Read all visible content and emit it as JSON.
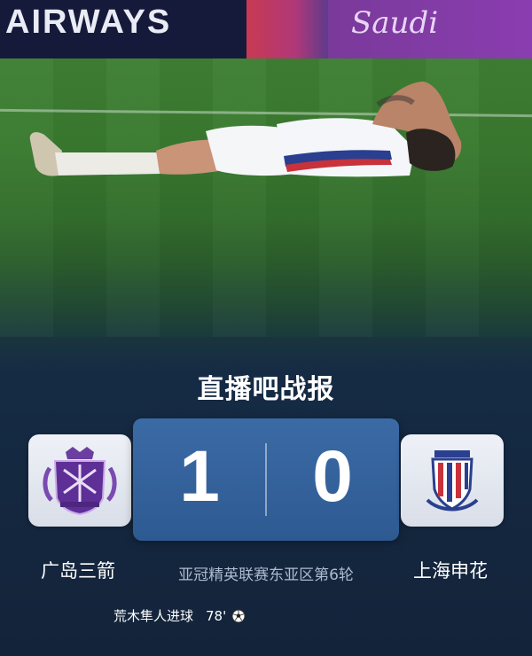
{
  "banner": {
    "sponsor_text": "AIRWAYS",
    "sponsor_text_right": "Saudi"
  },
  "header": {
    "title": "直播吧战报"
  },
  "match": {
    "home_team": "广岛三箭",
    "away_team": "上海申花",
    "home_score": "1",
    "away_score": "0",
    "competition": "亚冠精英联赛东亚区第6轮"
  },
  "events": [
    {
      "text": "荒木隼人进球",
      "minute": "78'",
      "icon": "soccer-ball-icon"
    }
  ],
  "colors": {
    "panel_bg": "#13233a",
    "score_box": "#3b6aa5",
    "accent_green": "#3ddc84",
    "crest_bg": "#eef1f7"
  }
}
